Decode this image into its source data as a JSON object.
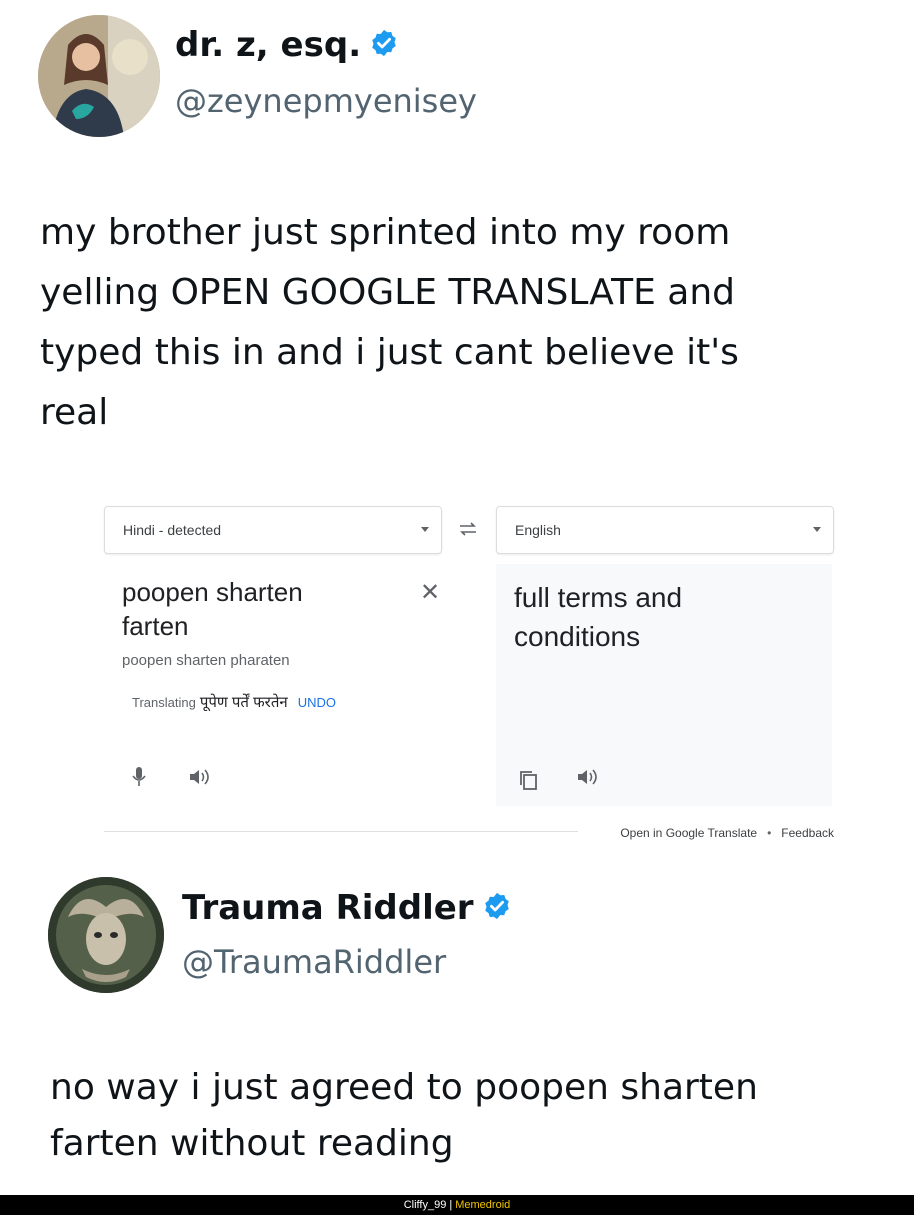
{
  "tweet1": {
    "display_name": "dr. z, esq.",
    "handle": "@zeynepmyenisey",
    "text_lines": [
      "my brother just sprinted into my room",
      "yelling OPEN GOOGLE TRANSLATE and",
      "typed this in and i just cant believe it's",
      "real"
    ]
  },
  "translate": {
    "source_lang": "Hindi - detected",
    "target_lang": "English",
    "input_text_lines": [
      "poopen sharten",
      "farten"
    ],
    "transliteration": "poopen sharten pharaten",
    "translating_label": "Translating",
    "translating_hindi": "पूपेण पर्तें फरतेन",
    "undo_label": "UNDO",
    "output_text_lines": [
      "full terms and",
      "conditions"
    ],
    "open_link": "Open in Google Translate",
    "separator": "•",
    "feedback_link": "Feedback"
  },
  "tweet2": {
    "display_name": "Trauma Riddler",
    "handle": "@TraumaRiddler",
    "text_lines": [
      "no way i just agreed to poopen sharten",
      "farten without reading"
    ]
  },
  "footer": {
    "user": "Cliffy_99 |",
    "brand": "Memedroid"
  },
  "colors": {
    "verified": "#1d9bf0",
    "link": "#1a73e8",
    "brand": "#f2c500"
  }
}
